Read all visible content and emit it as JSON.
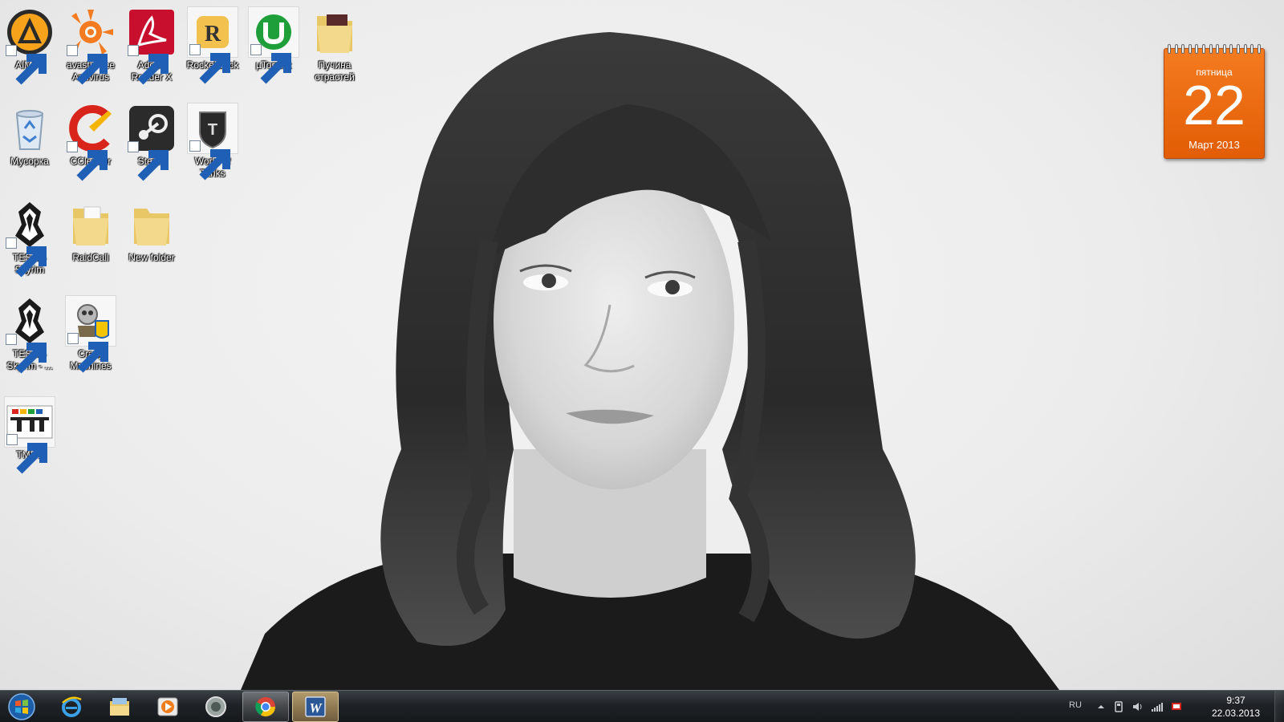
{
  "desktop": {
    "icons": [
      {
        "label": "AIMP3",
        "icon": "aimp-icon"
      },
      {
        "label": "avast! Free Antivirus",
        "icon": "avast-icon"
      },
      {
        "label": "Adobe Reader X",
        "icon": "adobe-reader-icon"
      },
      {
        "label": "RocketDock",
        "icon": "rocketdock-icon"
      },
      {
        "label": "µTorrent",
        "icon": "utorrent-icon"
      },
      {
        "label": "Пучина страстей",
        "icon": "folder-icon"
      },
      {
        "label": "Мусорка",
        "icon": "recycle-bin-icon"
      },
      {
        "label": "CCleaner",
        "icon": "ccleaner-icon"
      },
      {
        "label": "Steam",
        "icon": "steam-icon"
      },
      {
        "label": "World of Tanks",
        "icon": "world-of-tanks-icon"
      },
      {
        "label": "TES V - Skyrim",
        "icon": "skyrim-icon"
      },
      {
        "label": "RaidCall",
        "icon": "folder-icon"
      },
      {
        "label": "New folder",
        "icon": "folder-icon"
      },
      {
        "label": "TES V - Skyrim - ...",
        "icon": "skyrim-icon"
      },
      {
        "label": "Crazy Machines",
        "icon": "crazy-machines-icon"
      },
      {
        "label": "TMUF",
        "icon": "tmuf-icon"
      }
    ]
  },
  "calendar": {
    "weekday": "пятница",
    "day": "22",
    "month_year": "Март 2013",
    "color": "#f06e14"
  },
  "taskbar": {
    "pinned": [
      {
        "icon": "internet-explorer-icon"
      },
      {
        "icon": "windows-explorer-icon"
      },
      {
        "icon": "media-player-icon"
      },
      {
        "icon": "generic-app-icon"
      },
      {
        "icon": "chrome-icon",
        "state": "open"
      },
      {
        "icon": "word-icon",
        "state": "active"
      }
    ],
    "tray": {
      "language": "RU",
      "time": "9:37",
      "date": "22.03.2013"
    }
  }
}
